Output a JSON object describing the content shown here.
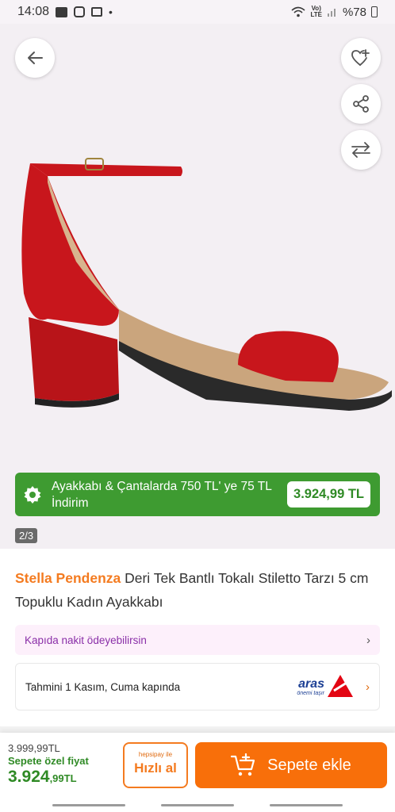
{
  "status_bar": {
    "time": "14:08",
    "dot": "•",
    "lte_top": "Vo)",
    "lte_bottom": "LTE",
    "battery": "%78"
  },
  "image": {
    "page_indicator": "2/3"
  },
  "promo": {
    "text": "Ayakkabı & Çantalarda 750 TL' ye 75 TL İndirim",
    "price": "3.924,99 TL",
    "color": "#3e9b31"
  },
  "product": {
    "brand": "Stella Pendenza",
    "title": " Deri Tek Bantlı Tokalı Stiletto Tarzı 5 cm Topuklu Kadın Ayakkabı",
    "brand_color": "#f47b20"
  },
  "payment": {
    "text": "Kapıda nakit ödeyebilirsin",
    "chevron": "›"
  },
  "delivery": {
    "text": "Tahmini 1 Kasım, Cuma kapında",
    "carrier": "aras",
    "carrier_slogan": "önemi taşır",
    "chevron": "›"
  },
  "bottom_bar": {
    "old_price": "3.999,99TL",
    "special_label": "Sepete özel fiyat",
    "special_price_main": "3.924",
    "special_price_rest": ",99TL",
    "hepsipay_label": "hepsipay ile",
    "quick_buy_label": "Hızlı al",
    "add_to_cart_label": "Sepete ekle",
    "accent_color": "#f86f0a"
  }
}
